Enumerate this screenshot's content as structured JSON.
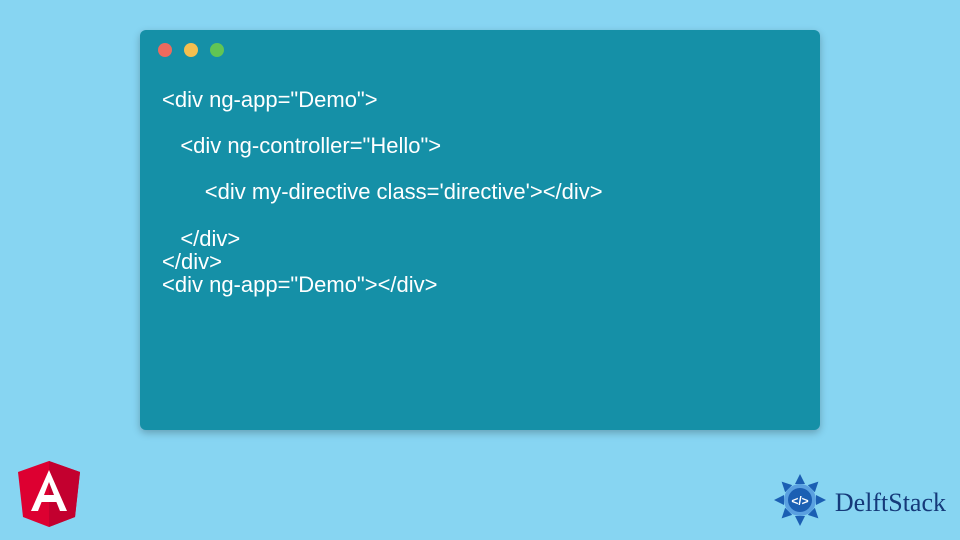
{
  "code": {
    "lines": "<div ng-app=\"Demo\">\n\n   <div ng-controller=\"Hello\">\n\n       <div my-directive class='directive'></div>\n\n   </div>\n</div>\n<div ng-app=\"Demo\"></div>"
  },
  "brand": {
    "name": "DelftStack"
  }
}
